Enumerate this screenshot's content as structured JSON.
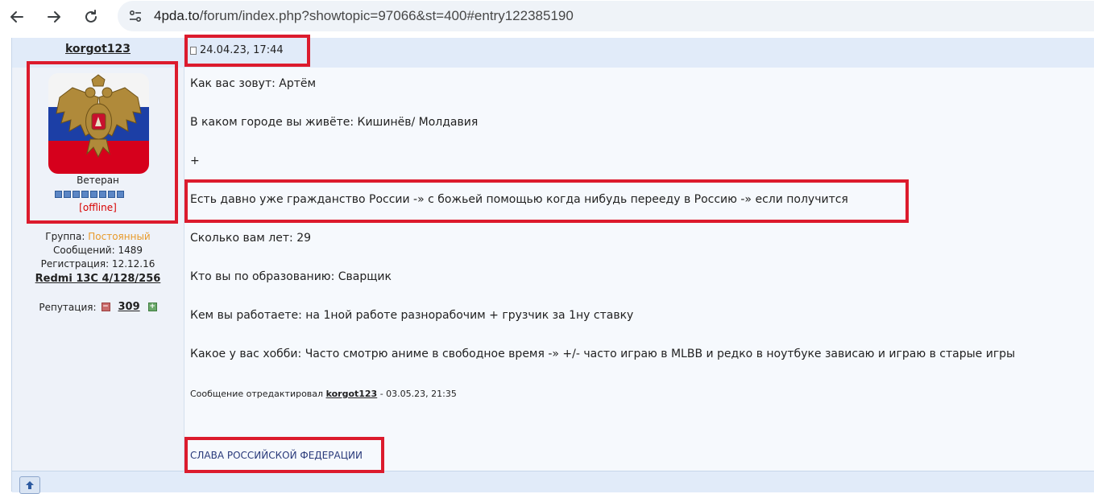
{
  "browser": {
    "url_host": "4pda.to",
    "url_rest": "/forum/index.php?showtopic=97066&st=400#entry122385190"
  },
  "author": {
    "username": "korgot123",
    "rank": "Ветеран",
    "status": "[offline]",
    "group_label": "Группа:",
    "group_value": "Постоянный",
    "posts": "Сообщений: 1489",
    "registration": "Регистрация: 12.12.16",
    "device": "Redmi 13C 4/128/256",
    "reputation_label": "Репутация:",
    "reputation_value": "309",
    "rank_pips": 8
  },
  "post": {
    "date": "24.04.23, 17:44",
    "lines": [
      "Как вас зовут: Артём",
      "В каком городе вы живёте: Кишинёв/ Молдавия",
      "+",
      "Есть давно уже гражданство России -» с божьей помощью когда нибудь переeду в Россию -» если получится",
      "Сколько вам лет: 29",
      "Кто вы по образованию: Сварщик",
      "Кем вы работаете: на 1ной работе разнорабочим + грузчик за 1ну ставку",
      "Какое у вас хобби: Часто смотрю аниме в свободное время -» +/- часто играю в MLBB и редко в ноутбуке зависаю и играю в старые игры"
    ],
    "edited_prefix": "Сообщение отредактировал",
    "edited_user": "korgot123",
    "edited_suffix": "- 03.05.23, 21:35",
    "signature_divider": "--------------------",
    "signature": "СЛАВА РОССИЙСКОЙ ФЕДЕРАЦИИ"
  },
  "colors": {
    "highlight": "#dc1b2d",
    "group": "#e89a2a",
    "offline": "#d80000"
  }
}
